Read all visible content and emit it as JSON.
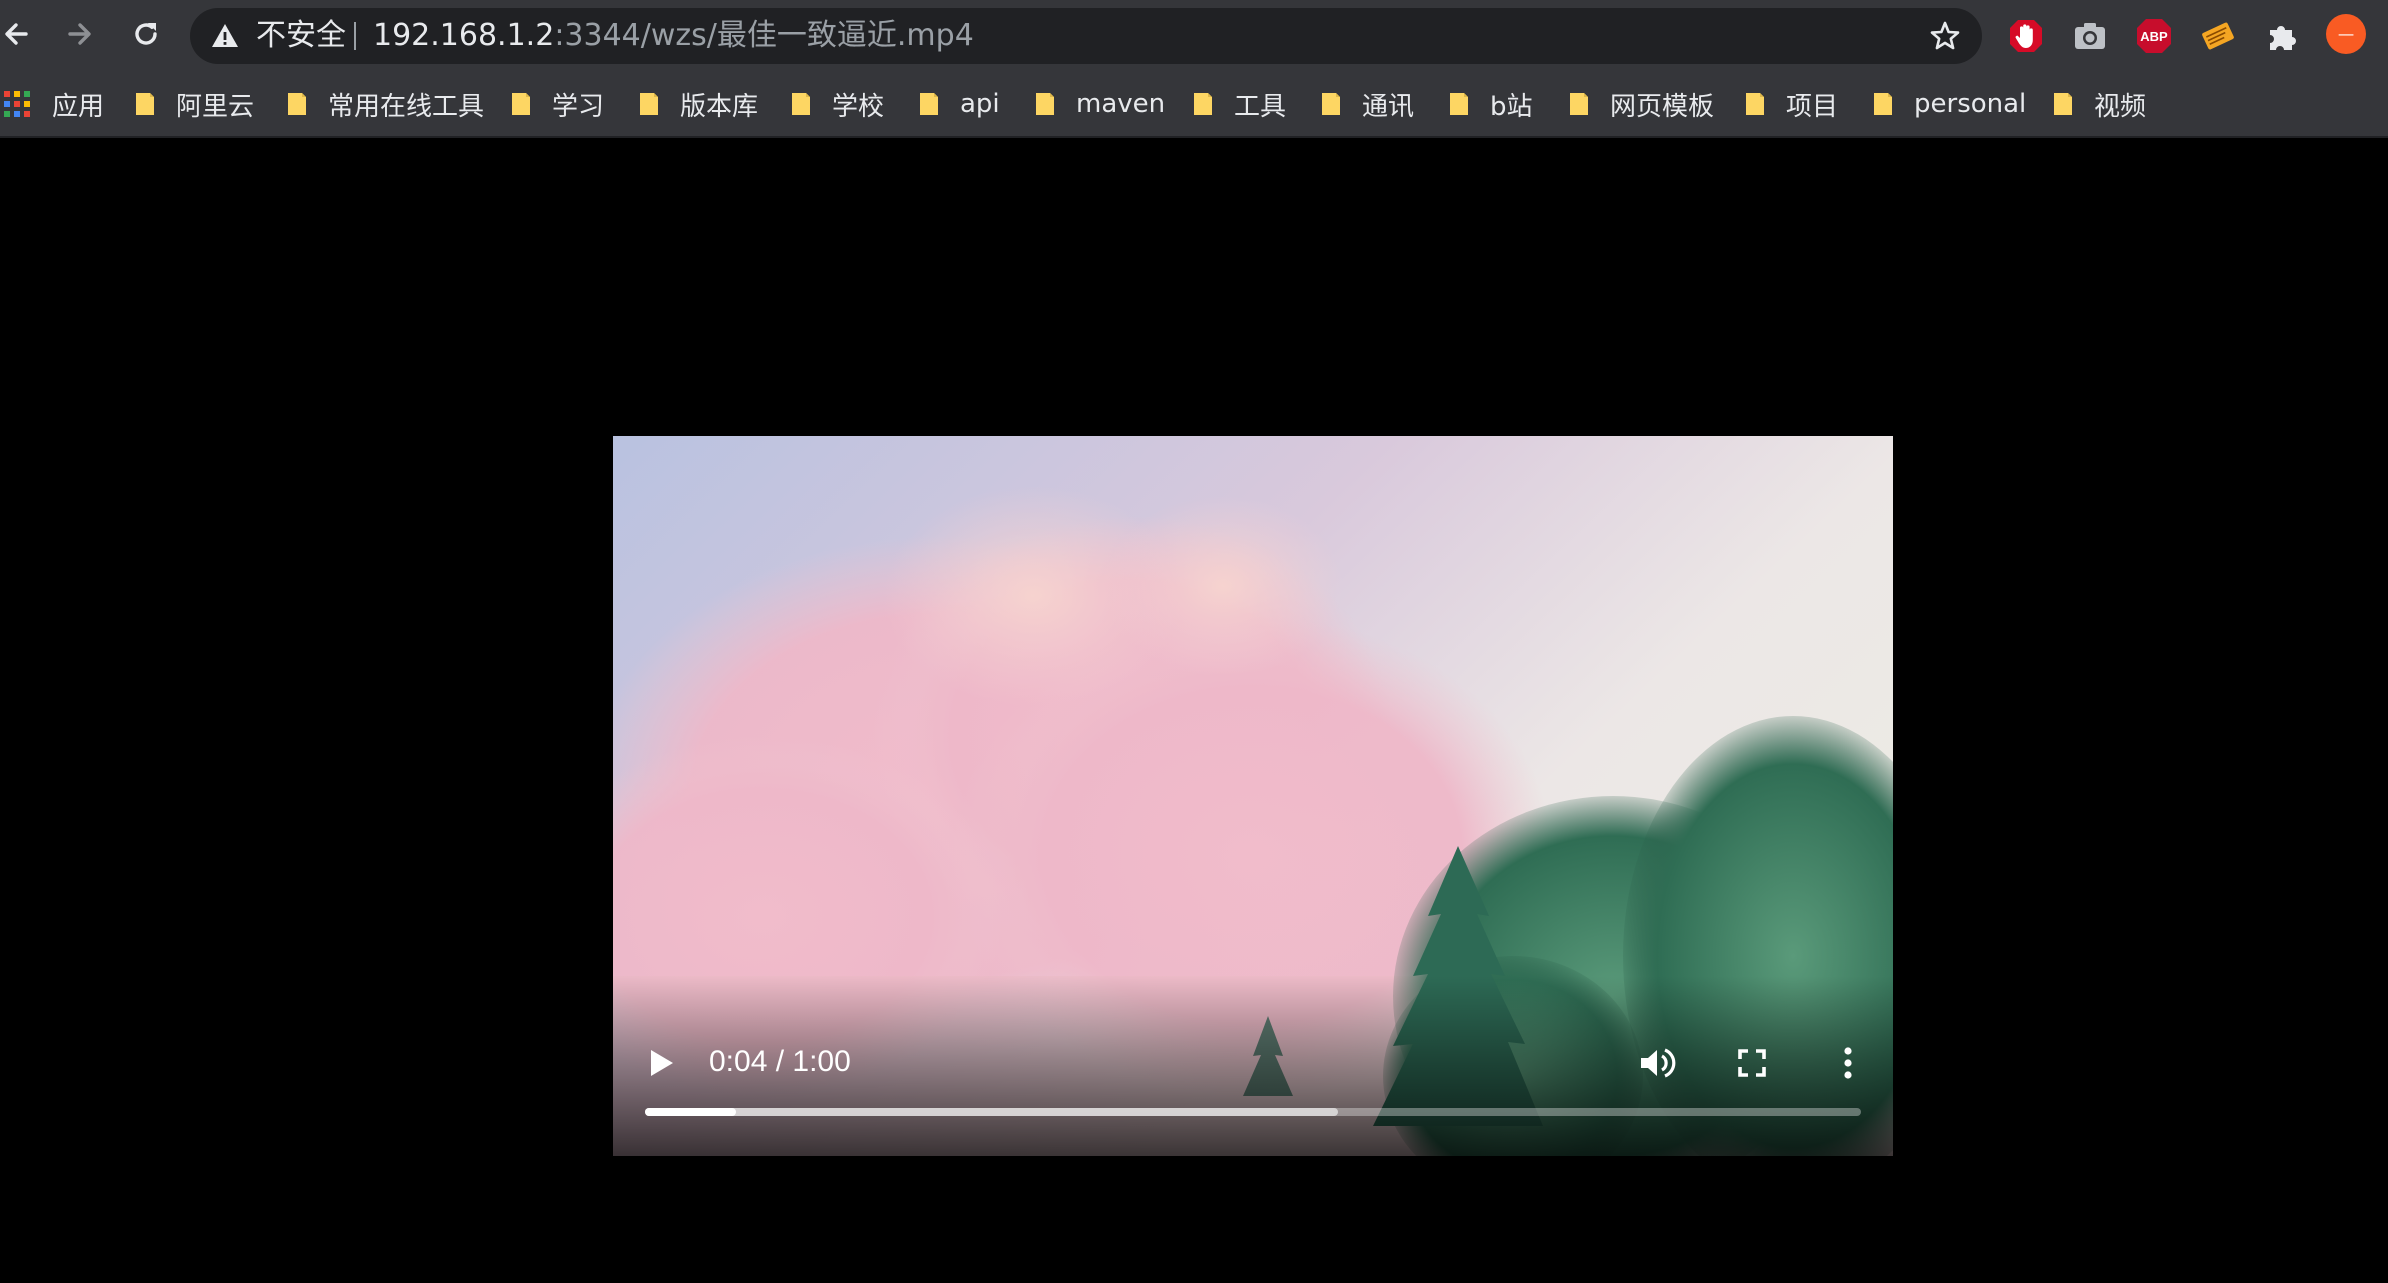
{
  "toolbar": {
    "security_label": "不安全",
    "url_host": "192.168.1.2",
    "url_rest": ":3344/wzs/最佳一致逼近.mp4",
    "icons": [
      "back-arrow-icon",
      "forward-arrow-icon",
      "reload-icon",
      "warning-icon",
      "star-icon"
    ],
    "extensions": {
      "adblock_label": "ABP",
      "profile_initial": "—"
    }
  },
  "bookmarks": {
    "apps_label": "应用",
    "folders": [
      "阿里云",
      "常用在线工具",
      "学习",
      "版本库",
      "学校",
      "api",
      "maven",
      "工具",
      "通讯",
      "b站",
      "网页模板",
      "项目",
      "personal",
      "视频"
    ]
  },
  "video": {
    "current_time": "0:04",
    "duration": "1:00",
    "time_display": "0:04 / 1:00",
    "played_fraction": 0.075,
    "buffered_fraction": 0.57
  },
  "colors": {
    "toolbar_bg": "#35363a",
    "omnibox_bg": "#202124",
    "folder_yellow": "#fdd663",
    "profile_orange": "#f95b23",
    "adblock_red": "#c70d2c"
  }
}
